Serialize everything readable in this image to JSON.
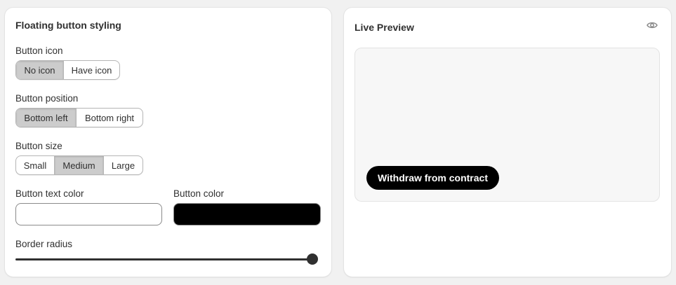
{
  "left_card": {
    "title": "Floating button styling",
    "icon_label": "Button icon",
    "icon_options": [
      "No icon",
      "Have icon"
    ],
    "icon_selected": "No icon",
    "position_label": "Button position",
    "position_options": [
      "Bottom left",
      "Bottom right"
    ],
    "position_selected": "Bottom left",
    "size_label": "Button size",
    "size_options": [
      "Small",
      "Medium",
      "Large"
    ],
    "size_selected": "Medium",
    "text_color_label": "Button text color",
    "text_color_value": "#ffffff",
    "button_color_label": "Button color",
    "button_color_value": "#000000",
    "radius_label": "Border radius",
    "radius_fraction": 1.0
  },
  "right_card": {
    "title": "Live Preview",
    "preview_icon": "eye-icon",
    "preview_button_label": "Withdraw from contract"
  },
  "colors": {
    "selected_segment": "#cccccc",
    "preview_button_bg": "#000000",
    "preview_button_text": "#ffffff"
  }
}
